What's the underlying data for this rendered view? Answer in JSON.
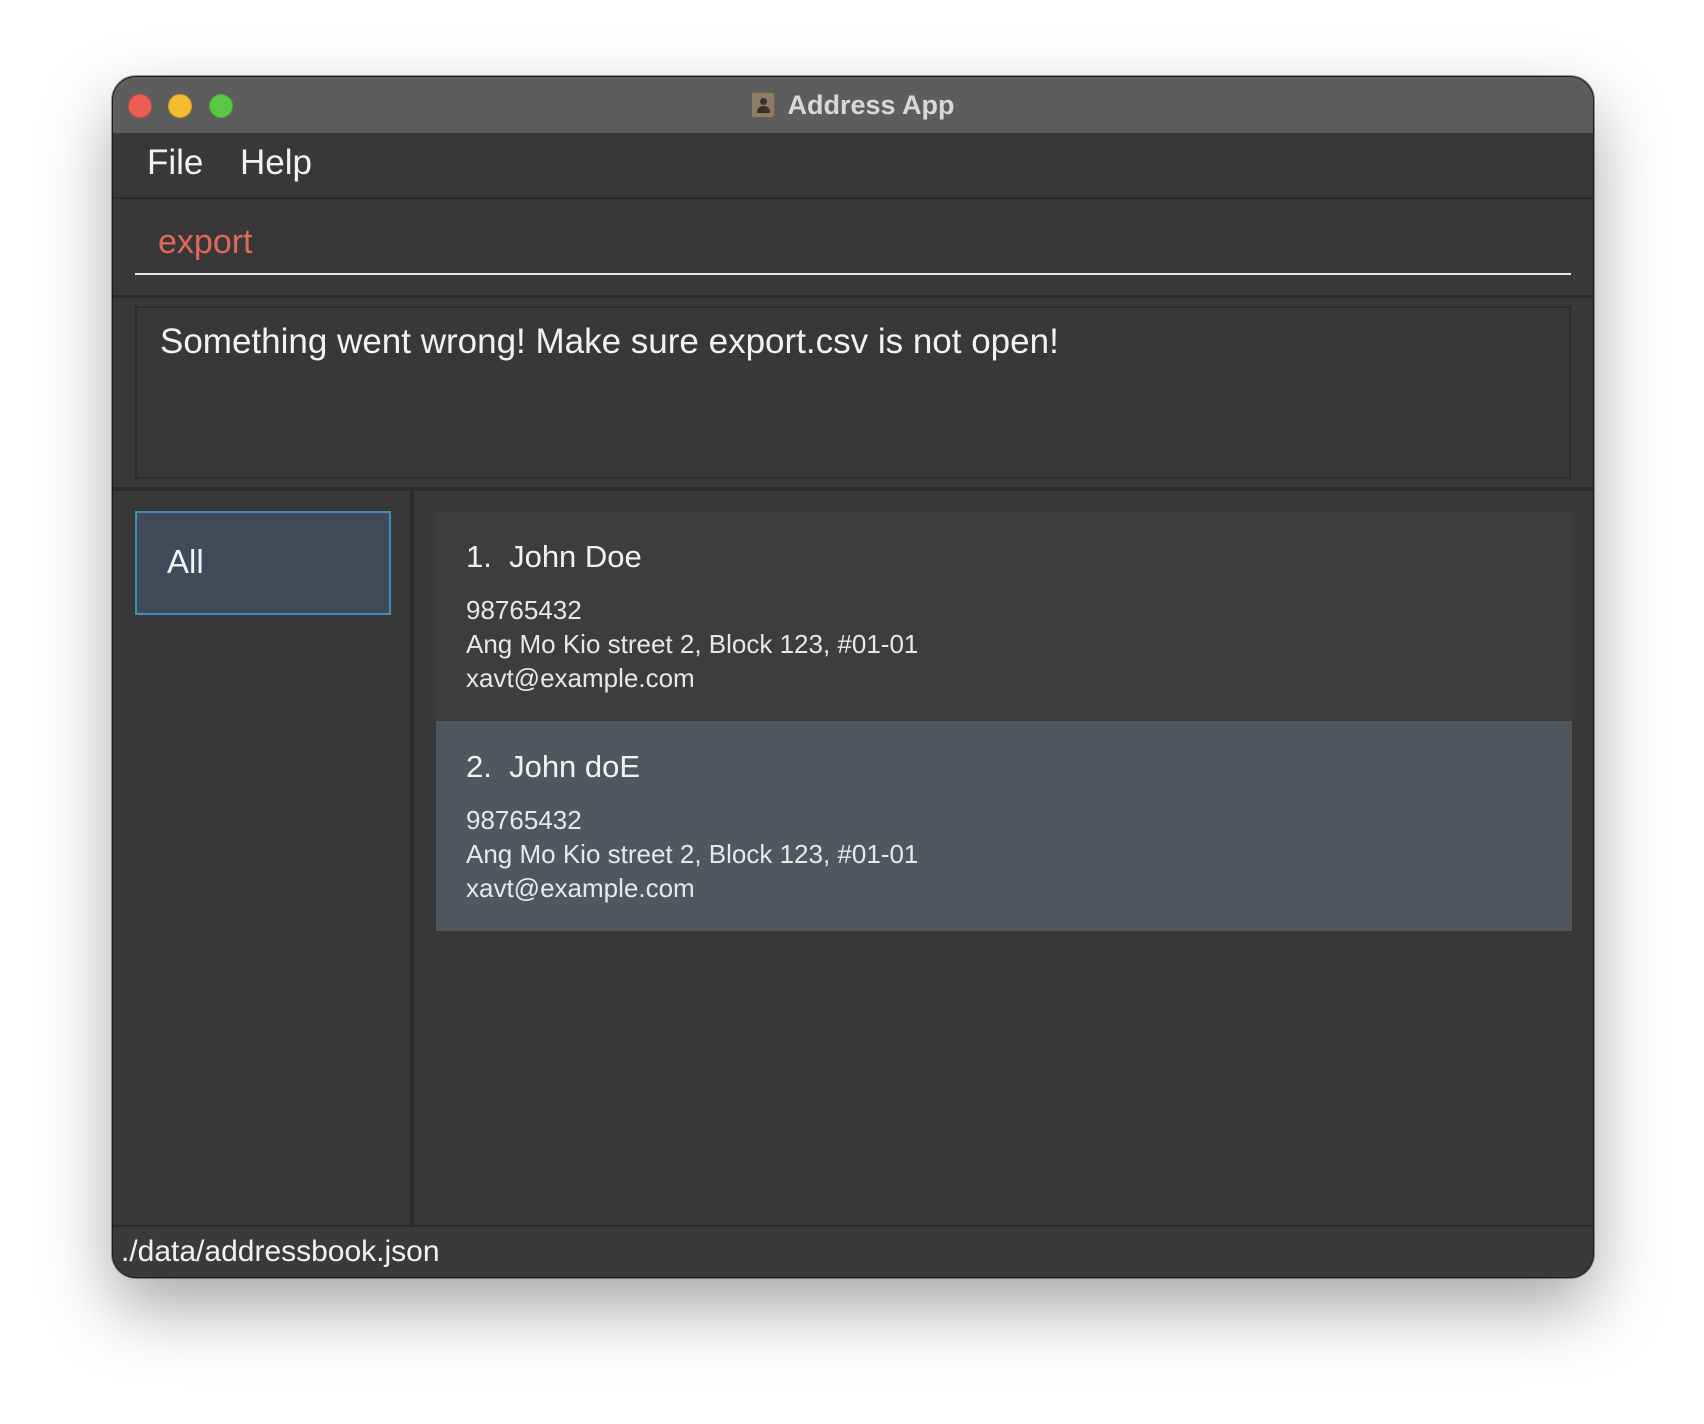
{
  "window": {
    "title": "Address App",
    "icon": "address-book-icon",
    "traffic_lights": {
      "close_color": "#ec5f55",
      "minimize_color": "#f3bc31",
      "maximize_color": "#5bc745"
    }
  },
  "menu": {
    "items": [
      {
        "label": "File"
      },
      {
        "label": "Help"
      }
    ]
  },
  "command_box": {
    "value": "export",
    "text_color": "#e0685a"
  },
  "result_display": {
    "message": "Something went wrong! Make sure export.csv is not open!"
  },
  "sidebar": {
    "items": [
      {
        "label": "All",
        "selected": true,
        "accent": "#3f8fb5"
      }
    ]
  },
  "persons": [
    {
      "index_name": "1.  John Doe",
      "phone": "98765432",
      "address": "Ang Mo Kio street 2, Block 123, #01-01",
      "email": "xavt@example.com",
      "selected": false
    },
    {
      "index_name": "2.  John doE",
      "phone": "98765432",
      "address": "Ang Mo Kio street 2, Block 123, #01-01",
      "email": "xavt@example.com",
      "selected": true
    }
  ],
  "status_bar": {
    "file_path": "./data/addressbook.json"
  }
}
